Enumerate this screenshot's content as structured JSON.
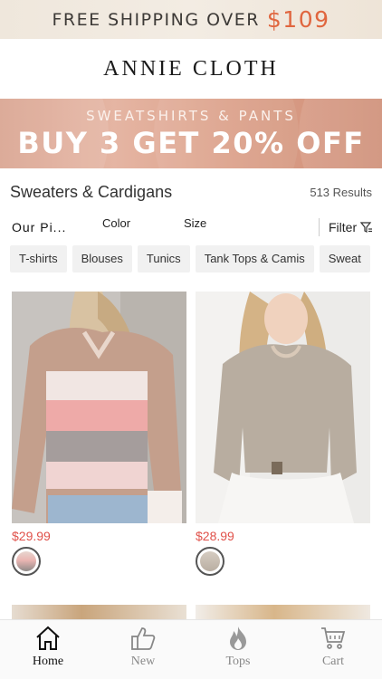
{
  "promo_bar": {
    "text": "FREE SHIPPING OVER",
    "amount": "$109"
  },
  "brand": "ANNIE CLOTH",
  "hero_banner": {
    "subtitle": "SWEATSHIRTS & PANTS",
    "headline": "BUY 3 GET 20% OFF"
  },
  "category": {
    "title": "Sweaters & Cardigans",
    "results": "513 Results"
  },
  "filters": {
    "sort": "Our Pi...",
    "color": "Color",
    "size": "Size",
    "filter": "Filter"
  },
  "chips": [
    "T-shirts",
    "Blouses",
    "Tunics",
    "Tank Tops & Camis",
    "Sweat"
  ],
  "products": [
    {
      "price": "$29.99",
      "colors": [
        "#d9a893",
        "#eab5b2",
        "#8f8a88"
      ]
    },
    {
      "price": "$28.99",
      "colors": [
        "#b9aea2",
        "#cfc5b8"
      ]
    }
  ],
  "bottom_nav": [
    {
      "label": "Home",
      "icon": "home-icon",
      "active": true
    },
    {
      "label": "New",
      "icon": "thumbs-up-icon",
      "active": false
    },
    {
      "label": "Tops",
      "icon": "flame-icon",
      "active": false
    },
    {
      "label": "Cart",
      "icon": "cart-icon",
      "active": false
    }
  ],
  "colors": {
    "price": "#e0514a",
    "accent": "#e0663f"
  }
}
